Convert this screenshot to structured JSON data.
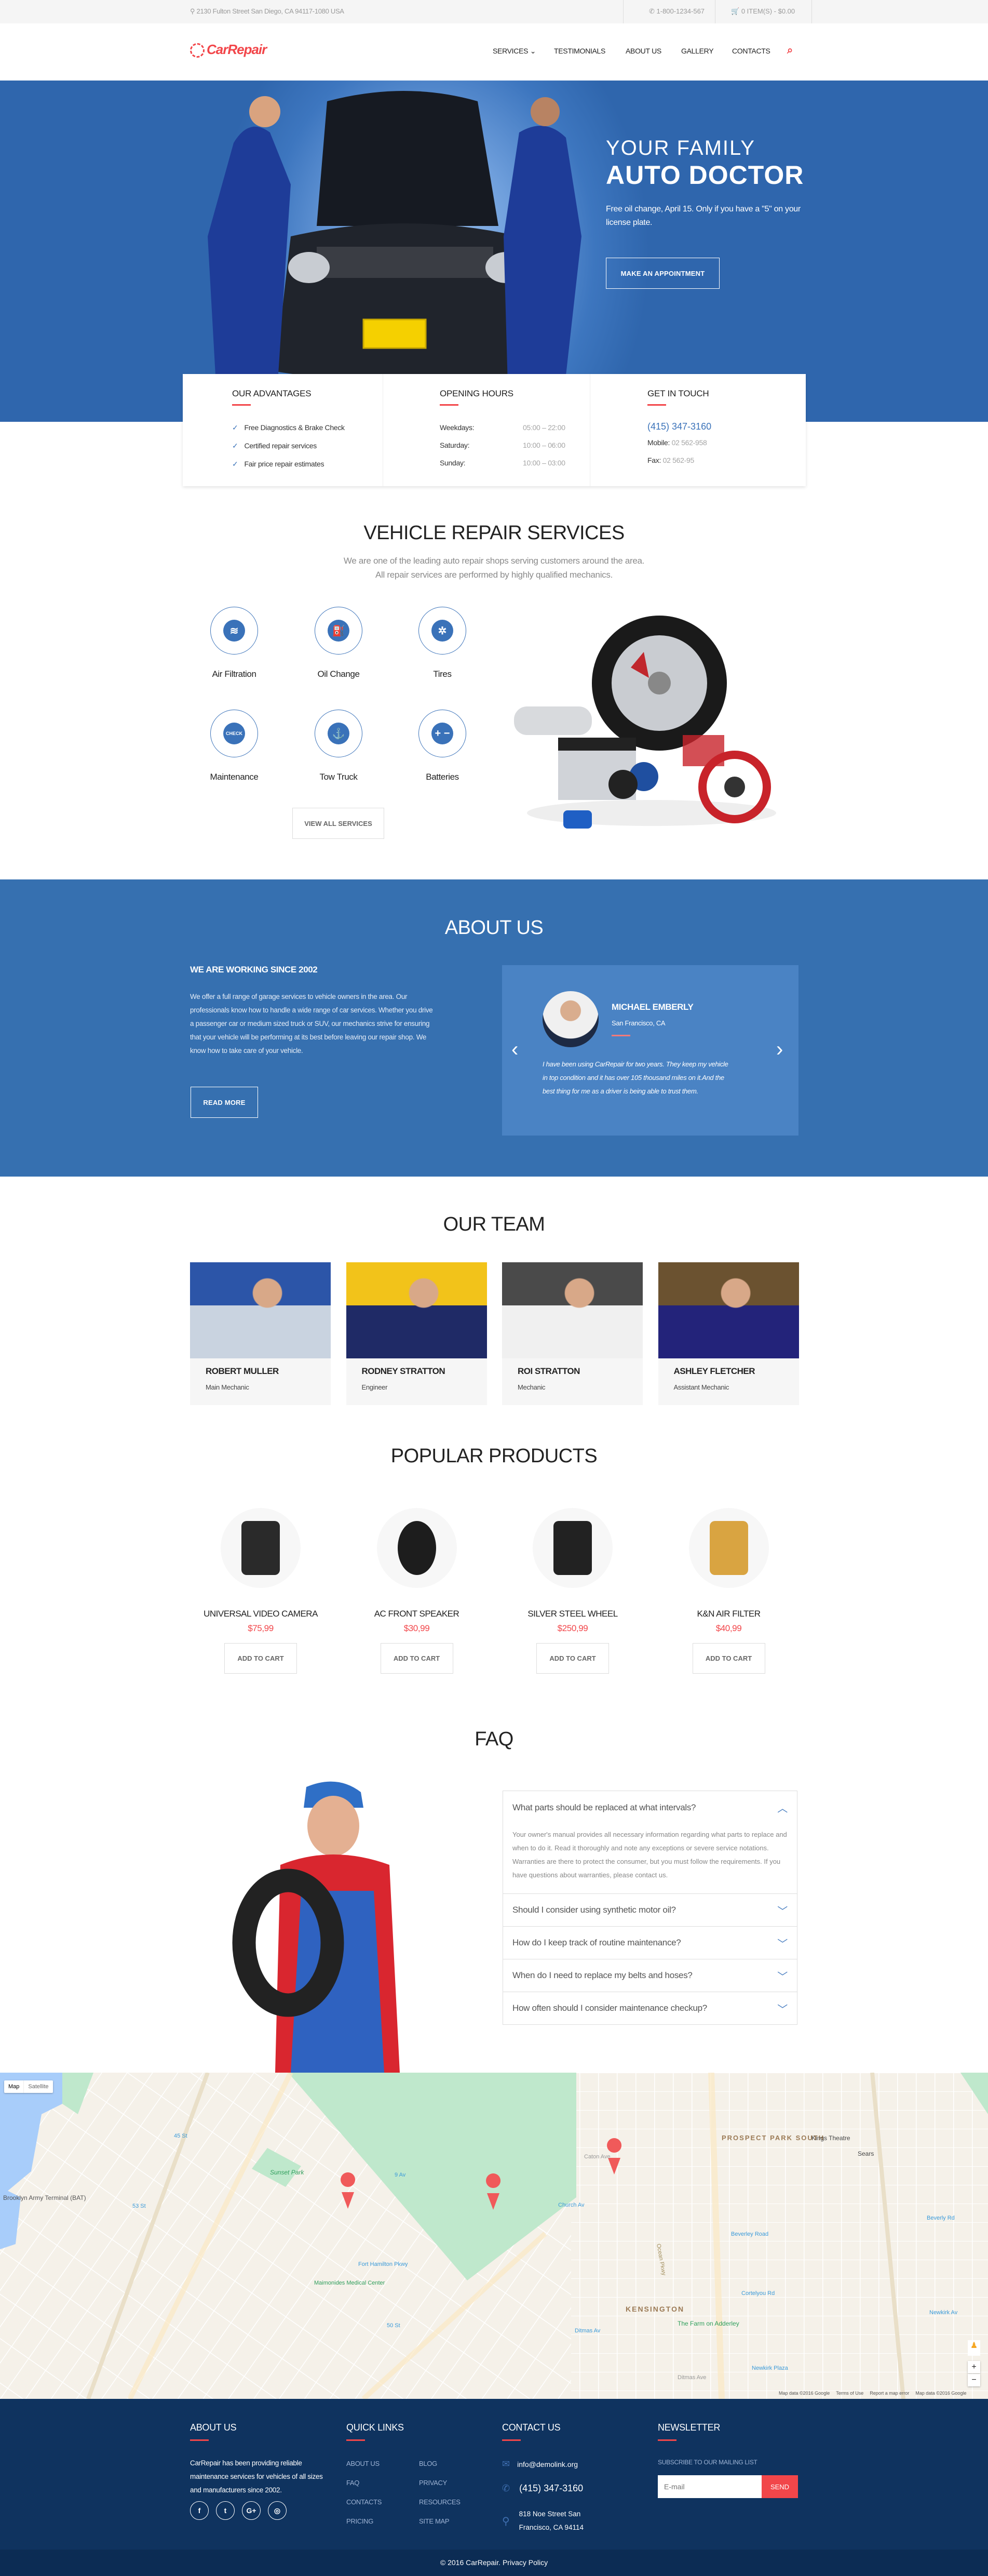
{
  "topbar": {
    "address": "2130 Fulton Street San Diego, CA 94117-1080 USA",
    "phone": "1-800-1234-567",
    "cart": "0 ITEM(S) - $0.00"
  },
  "header": {
    "logo": "CarRepair",
    "nav": [
      {
        "label": "SERVICES ⌄"
      },
      {
        "label": "TESTIMONIALS"
      },
      {
        "label": "ABOUT US"
      },
      {
        "label": "GALLERY"
      },
      {
        "label": "CONTACTS"
      }
    ]
  },
  "hero": {
    "line1": "YOUR FAMILY",
    "line2": "AUTO DOCTOR",
    "text": "Free oil change, April 15. Only if you have a \"5\" on your license plate.",
    "button": "MAKE AN APPOINTMENT"
  },
  "info": {
    "advantages": {
      "title": "OUR ADVANTAGES",
      "items": [
        "Free Diagnostics & Brake Check",
        "Certified repair services",
        "Fair price repair estimates"
      ]
    },
    "hours": {
      "title": "OPENING HOURS",
      "rows": [
        {
          "day": "Weekdays:",
          "time": "05:00 – 22:00"
        },
        {
          "day": "Saturday:",
          "time": "10:00 – 06:00"
        },
        {
          "day": "Sunday:",
          "time": "10:00 – 03:00"
        }
      ]
    },
    "contact": {
      "title": "GET IN TOUCH",
      "phone": "(415) 347-3160",
      "mobile_label": "Mobile:",
      "mobile": "02 562-958",
      "fax_label": "Fax:",
      "fax": "02 562-95"
    }
  },
  "services": {
    "title": "VEHICLE REPAIR SERVICES",
    "subtitle1": "We are one of the leading auto repair shops serving customers around the area.",
    "subtitle2": "All repair services are performed by highly qualified mechanics.",
    "items": [
      {
        "label": "Air Filtration",
        "icon": "air-filter-icon",
        "glyph": "≋"
      },
      {
        "label": "Oil Change",
        "icon": "oil-can-icon",
        "glyph": "⛽"
      },
      {
        "label": "Tires",
        "icon": "wheel-icon",
        "glyph": "✲"
      },
      {
        "label": "Maintenance",
        "icon": "check-engine-icon",
        "glyph": "CHECK"
      },
      {
        "label": "Tow Truck",
        "icon": "tow-truck-icon",
        "glyph": "⚓"
      },
      {
        "label": "Batteries",
        "icon": "battery-icon",
        "glyph": "+ −"
      }
    ],
    "button": "VIEW ALL SERVICES"
  },
  "about": {
    "title": "ABOUT US",
    "heading": "WE ARE WORKING SINCE 2002",
    "text": "We offer a full range of garage services to vehicle owners in the area. Our professionals know how to handle a wide range of car services. Whether you drive a passenger car or medium sized truck or SUV, our mechanics strive for ensuring that your vehicle will be performing at its best before leaving our repair shop. We know how to take care of your vehicle.",
    "button": "READ MORE",
    "testimonial": {
      "name": "MICHAEL EMBERLY",
      "location": "San Francisco, CA",
      "quote": "I have been using CarRepair for two years. They keep my vehicle in top condition and it has over 105 thousand miles on it.And the best thing for me as a driver is being able to trust them."
    }
  },
  "team": {
    "title": "OUR TEAM",
    "members": [
      {
        "name": "ROBERT MULLER",
        "role": "Main Mechanic"
      },
      {
        "name": "RODNEY STRATTON",
        "role": "Engineer"
      },
      {
        "name": "ROI STRATTON",
        "role": "Mechanic"
      },
      {
        "name": "ASHLEY FLETCHER",
        "role": "Assistant Mechanic"
      }
    ]
  },
  "products": {
    "title": "POPULAR PRODUCTS",
    "items": [
      {
        "name": "UNIVERSAL VIDEO CAMERA",
        "price": "$75,99",
        "button": "ADD TO CART"
      },
      {
        "name": "AC FRONT SPEAKER",
        "price": "$30,99",
        "button": "ADD TO CART"
      },
      {
        "name": "SILVER STEEL WHEEL",
        "price": "$250,99",
        "button": "ADD TO CART"
      },
      {
        "name": "K&N AIR FILTER",
        "price": "$40,99",
        "button": "ADD TO CART"
      }
    ]
  },
  "faq": {
    "title": "FAQ",
    "items": [
      {
        "q": "What parts should be replaced at what intervals?",
        "a": "Your owner's manual provides all necessary information regarding what parts to replace and when to do it. Read it thoroughly and note any exceptions or severe service notations. Warranties are there to protect the consumer, but you must follow the requirements. If you have questions about warranties, please contact us.",
        "open": true
      },
      {
        "q": "Should I consider using synthetic motor oil?",
        "open": false
      },
      {
        "q": "How do I keep track of routine maintenance?",
        "open": false
      },
      {
        "q": "When do I need to replace my belts and hoses?",
        "open": false
      },
      {
        "q": "How often should I consider maintenance checkup?",
        "open": false
      }
    ]
  },
  "map": {
    "type_map": "Map",
    "type_satellite": "Satellite",
    "labels": [
      "Brooklyn Army Terminal (BAT)",
      "Sunset Park",
      "45 St",
      "53 St",
      "Maimonides Medical Center",
      "Fort Hamilton Pkwy",
      "9 Av",
      "50 St",
      "Church Av",
      "Ditmas Av",
      "KENSINGTON",
      "PROSPECT PARK SOUTH",
      "Kings Theatre",
      "Sears",
      "Beverley Road",
      "Cortelyou Rd",
      "Newkirk Plaza",
      "Newkirk Av",
      "Beverly Rd",
      "The Farm on Adderley",
      "Ocean Pkwy",
      "Caton Ave",
      "Ditmas Ave"
    ],
    "attribution": "Map data ©2016 Google",
    "terms": "Terms of Use",
    "report": "Report a map error",
    "zoom_in": "+",
    "zoom_out": "−",
    "pin_color": "#f05a5a"
  },
  "footer": {
    "about": {
      "title": "ABOUT US",
      "text": "CarRepair has been providing reliable maintenance services for vehicles of all sizes and manufacturers since 2002."
    },
    "social": [
      {
        "icon": "facebook-icon",
        "glyph": "f"
      },
      {
        "icon": "twitter-icon",
        "glyph": "t"
      },
      {
        "icon": "google-plus-icon",
        "glyph": "G+"
      },
      {
        "icon": "instagram-icon",
        "glyph": "◎"
      }
    ],
    "links": {
      "title": "QUICK LINKS",
      "col1": [
        "ABOUT US",
        "FAQ",
        "CONTACTS",
        "PRICING"
      ],
      "col2": [
        "BLOG",
        "PRIVACY",
        "RESOURCES",
        "SITE MAP"
      ]
    },
    "contact": {
      "title": "CONTACT US",
      "email": "info@demolink.org",
      "phone": "(415) 347-3160",
      "address": "818 Noe Street San Francisco, CA 94114"
    },
    "newsletter": {
      "title": "NEWSLETTER",
      "label": "SUBSCRIBE TO OUR MAILING LIST",
      "placeholder": "E-mail",
      "button": "SEND"
    },
    "copyright": "© 2016 CarRepair. Privacy Policy"
  },
  "colors": {
    "accent": "#f2464a",
    "brand_blue": "#3670b0",
    "footer": "#0f335f"
  }
}
